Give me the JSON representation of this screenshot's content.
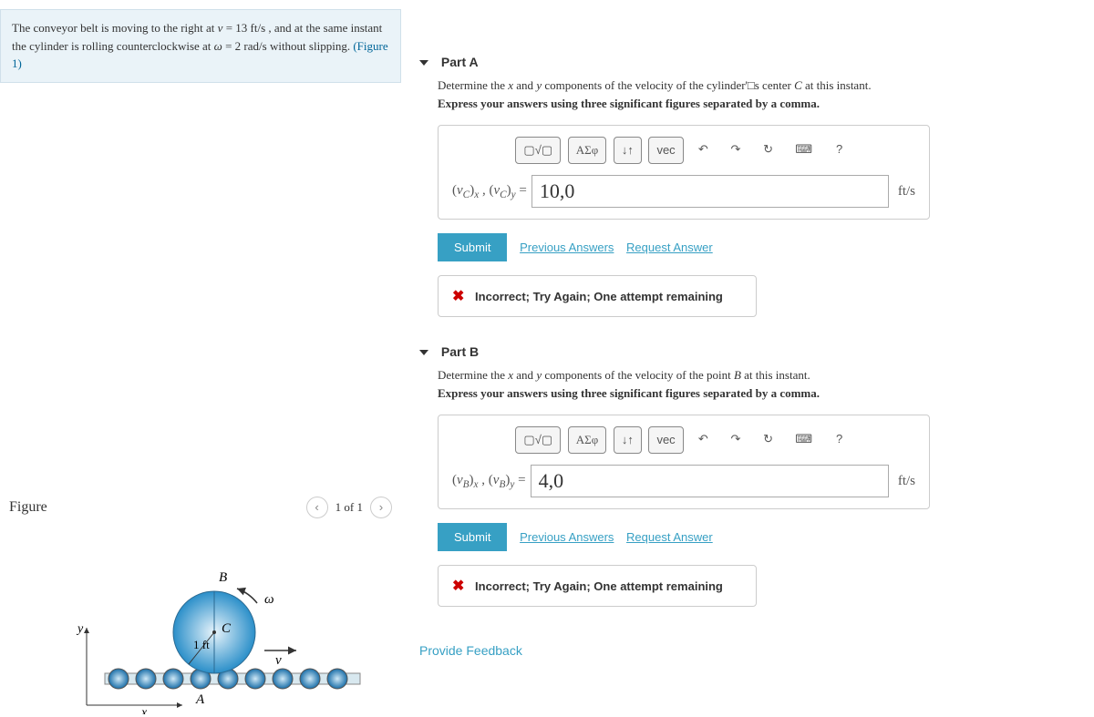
{
  "problem": {
    "text_prefix": "The conveyor belt is moving to the right at ",
    "v_sym": "v",
    "v_eq": " = 13  ft/s , and at the same instant the cylinder is rolling counterclockwise at ",
    "w_sym": "ω",
    "w_eq": " = 2 rad/s without slipping. ",
    "fig_link": "(Figure 1)"
  },
  "figure": {
    "title": "Figure",
    "pager": "1 of 1",
    "labels": {
      "B": "B",
      "C": "C",
      "A": "A",
      "r": "1 ft",
      "omega": "ω",
      "v": "v",
      "x": "x",
      "y": "y"
    }
  },
  "partA": {
    "title": "Part A",
    "instr1": "Determine the x and y components of the velocity of the cylinder's center C at this instant.",
    "instr2": "Express your answers using three significant figures separated by a comma.",
    "label_html": "(vC)x , (vC)y = ",
    "value": "10,0",
    "unit": "ft/s",
    "submit": "Submit",
    "prev": "Previous Answers",
    "req": "Request Answer",
    "feedback": "Incorrect; Try Again; One attempt remaining"
  },
  "partB": {
    "title": "Part B",
    "instr1": "Determine the x and y components of the velocity of the point B at this instant.",
    "instr2": "Express your answers using three significant figures separated by a comma.",
    "label_html": "(vB)x , (vB)y = ",
    "value": "4,0",
    "unit": "ft/s",
    "submit": "Submit",
    "prev": "Previous Answers",
    "req": "Request Answer",
    "feedback": "Incorrect; Try Again; One attempt remaining"
  },
  "toolbar": {
    "templates": "▢√▢",
    "greek": "ΑΣφ",
    "subsup": "↓↑",
    "vec": "vec",
    "undo": "↶",
    "redo": "↷",
    "reset": "↻",
    "keyboard": "⌨",
    "help": "?"
  },
  "provide_feedback": "Provide Feedback"
}
